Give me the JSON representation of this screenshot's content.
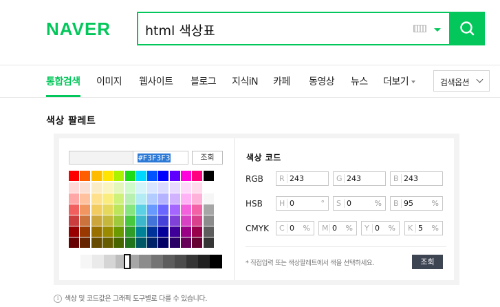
{
  "brand": {
    "name": "NAVER",
    "color": "#03c75a"
  },
  "search": {
    "query": "html 색상표",
    "keyboard_icon": "keyboard-icon",
    "dropdown_icon": "caret-down-icon",
    "button_icon": "magnifier-icon"
  },
  "nav": {
    "items": [
      {
        "label": "통합검색",
        "active": true
      },
      {
        "label": "이미지"
      },
      {
        "label": "웹사이트"
      },
      {
        "label": "블로그"
      },
      {
        "label": "지식iN"
      },
      {
        "label": "카페"
      },
      {
        "label": "동영상"
      },
      {
        "label": "뉴스"
      },
      {
        "label": "더보기"
      }
    ],
    "options_label": "검색옵션"
  },
  "palette": {
    "title": "색상 팔레트",
    "hex_value": "#F3F3F3",
    "lookup_button": "조회",
    "top_row": [
      "#ff0000",
      "#ff5e00",
      "#ffbb00",
      "#ffe400",
      "#abf200",
      "#1ddb16",
      "#00d8ff",
      "#0054ff",
      "#0100ff",
      "#5f00ff",
      "#ff00dd",
      "#ff007f",
      "#000000"
    ],
    "shade_rows": [
      [
        "#ffd8d8",
        "#fae0d4",
        "#faecc5",
        "#faf4c0",
        "#e4f7ba",
        "#cefbc9",
        "#d4f4fa",
        "#d9e5ff",
        "#dad9ff",
        "#e8d9ff",
        "#ffd9fa",
        "#ffd9ec",
        "#ffffff"
      ],
      [
        "#ffa7a7",
        "#ffc19e",
        "#ffe08c",
        "#faed7d",
        "#cef279",
        "#b7f0b1",
        "#b2ebf4",
        "#b2ccff",
        "#b5b2ff",
        "#d1b2ff",
        "#ffb2f5",
        "#ffb2d9",
        "#f6f6f6"
      ],
      [
        "#f15f5f",
        "#f29661",
        "#f2cb61",
        "#e5d85c",
        "#bce55c",
        "#86e57f",
        "#5cd1e5",
        "#6799ff",
        "#6b66ff",
        "#a566ff",
        "#f361dc",
        "#f361a6",
        "#a6a6a6"
      ],
      [
        "#cc3d3d",
        "#cc723d",
        "#cca63d",
        "#c4b73b",
        "#9fc93c",
        "#47c83e",
        "#3db7cc",
        "#4374d9",
        "#4641d9",
        "#8041d9",
        "#d941c5",
        "#d9418c",
        "#8c8c8c"
      ],
      [
        "#980000",
        "#993800",
        "#997000",
        "#998a00",
        "#6b9900",
        "#2f9d27",
        "#008299",
        "#003399",
        "#050099",
        "#3f0099",
        "#990085",
        "#99004c",
        "#5d5d5d"
      ],
      [
        "#670000",
        "#662500",
        "#664b00",
        "#665c00",
        "#476600",
        "#22741c",
        "#005766",
        "#002266",
        "#030066",
        "#2a0066",
        "#660058",
        "#660033",
        "#353535"
      ]
    ],
    "grayscale": [
      "#ffffff",
      "#f6f6f6",
      "#eaeaea",
      "#d5d5d5",
      "#bdbdbd",
      "#a6a6a6",
      "#8c8c8c",
      "#747474",
      "#5d5d5d",
      "#4c4c4c",
      "#353535",
      "#212121",
      "#000000"
    ]
  },
  "color_code": {
    "title": "색상 코드",
    "rgb": {
      "label": "RGB",
      "fields": [
        {
          "prefix": "R",
          "value": "243"
        },
        {
          "prefix": "G",
          "value": "243"
        },
        {
          "prefix": "B",
          "value": "243"
        }
      ]
    },
    "hsb": {
      "label": "HSB",
      "fields": [
        {
          "prefix": "H",
          "value": "0",
          "unit": "°"
        },
        {
          "prefix": "S",
          "value": "0",
          "unit": "%"
        },
        {
          "prefix": "B",
          "value": "95",
          "unit": "%"
        }
      ]
    },
    "cmyk": {
      "label": "CMYK",
      "fields": [
        {
          "prefix": "C",
          "value": "0",
          "unit": "%"
        },
        {
          "prefix": "M",
          "value": "0",
          "unit": "%"
        },
        {
          "prefix": "Y",
          "value": "0",
          "unit": "%"
        },
        {
          "prefix": "K",
          "value": "5",
          "unit": "%"
        }
      ]
    },
    "hint": "* 직접입력 또는 색상팔레트에서 색을 선택하세요.",
    "apply_button": "조회"
  },
  "footnote": "색상 및 코드값은 그래픽 도구별로 다를 수 있습니다."
}
